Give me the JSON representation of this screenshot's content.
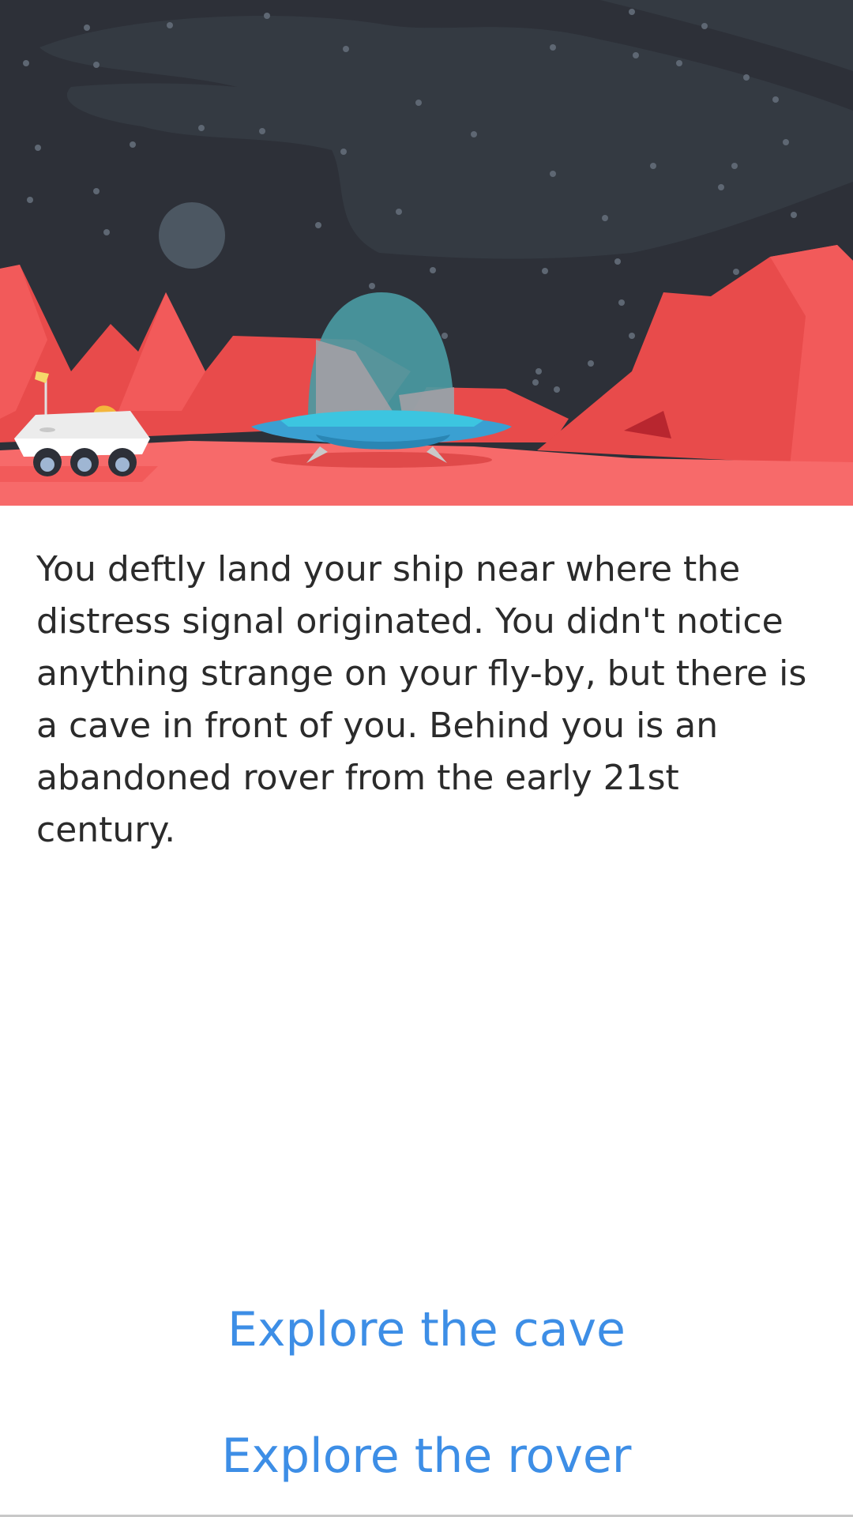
{
  "story": {
    "text": "You deftly land your ship near where the distress signal originated. You didn't notice anything strange on your fly-by, but there is a cave in front of you. Behind you is an abandoned rover from the early 21st century."
  },
  "choices": [
    {
      "label": "Explore the cave"
    },
    {
      "label": "Explore the rover"
    }
  ],
  "colors": {
    "sky": "#2d3038",
    "ground": "#f76a6a",
    "link": "#3d8ee6",
    "ship": "#3a9fd0"
  }
}
